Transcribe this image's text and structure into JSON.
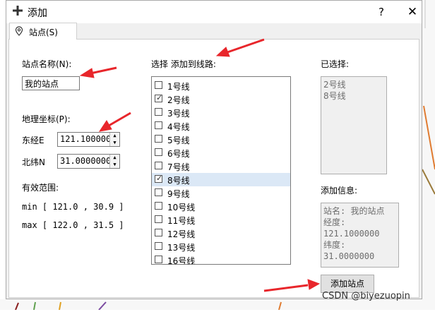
{
  "window": {
    "title": "添加",
    "help_label": "?",
    "close_label": "✕"
  },
  "tab": {
    "label": "站点(S)"
  },
  "name_section": {
    "label": "站点名称(N):",
    "value": "我的站点"
  },
  "coord_section": {
    "label": "地理坐标(P):",
    "lon_label": "东经E",
    "lon_value": "121.100000",
    "lat_label": "北纬N",
    "lat_value": "31.0000000",
    "range_label": "有效范围:",
    "min_line": "min [ 121.0 , 30.9 ]",
    "max_line": "max [ 122.0 , 31.5 ]"
  },
  "lines_section": {
    "label": "选择 添加到线路:",
    "items": [
      {
        "label": "1号线",
        "checked": false,
        "selected": false
      },
      {
        "label": "2号线",
        "checked": true,
        "selected": false
      },
      {
        "label": "3号线",
        "checked": false,
        "selected": false
      },
      {
        "label": "4号线",
        "checked": false,
        "selected": false
      },
      {
        "label": "5号线",
        "checked": false,
        "selected": false
      },
      {
        "label": "6号线",
        "checked": false,
        "selected": false
      },
      {
        "label": "7号线",
        "checked": false,
        "selected": false
      },
      {
        "label": "8号线",
        "checked": true,
        "selected": true
      },
      {
        "label": "9号线",
        "checked": false,
        "selected": false
      },
      {
        "label": "10号线",
        "checked": false,
        "selected": false
      },
      {
        "label": "11号线",
        "checked": false,
        "selected": false
      },
      {
        "label": "12号线",
        "checked": false,
        "selected": false
      },
      {
        "label": "13号线",
        "checked": false,
        "selected": false
      },
      {
        "label": "16号线",
        "checked": false,
        "selected": false
      }
    ]
  },
  "selected_section": {
    "label": "已选择:",
    "lines": [
      "2号线",
      "8号线"
    ]
  },
  "info_section": {
    "label": "添加信息:",
    "lines": [
      "站名: 我的站点",
      "经度: 121.1000000",
      "纬度: 31.0000000"
    ]
  },
  "add_button": {
    "label": "添加站点"
  },
  "watermark": {
    "text": "CSDN @biyezuopin"
  },
  "colors": {
    "annotation_arrow": "#e8262b",
    "selection": "#dbe8f6"
  }
}
